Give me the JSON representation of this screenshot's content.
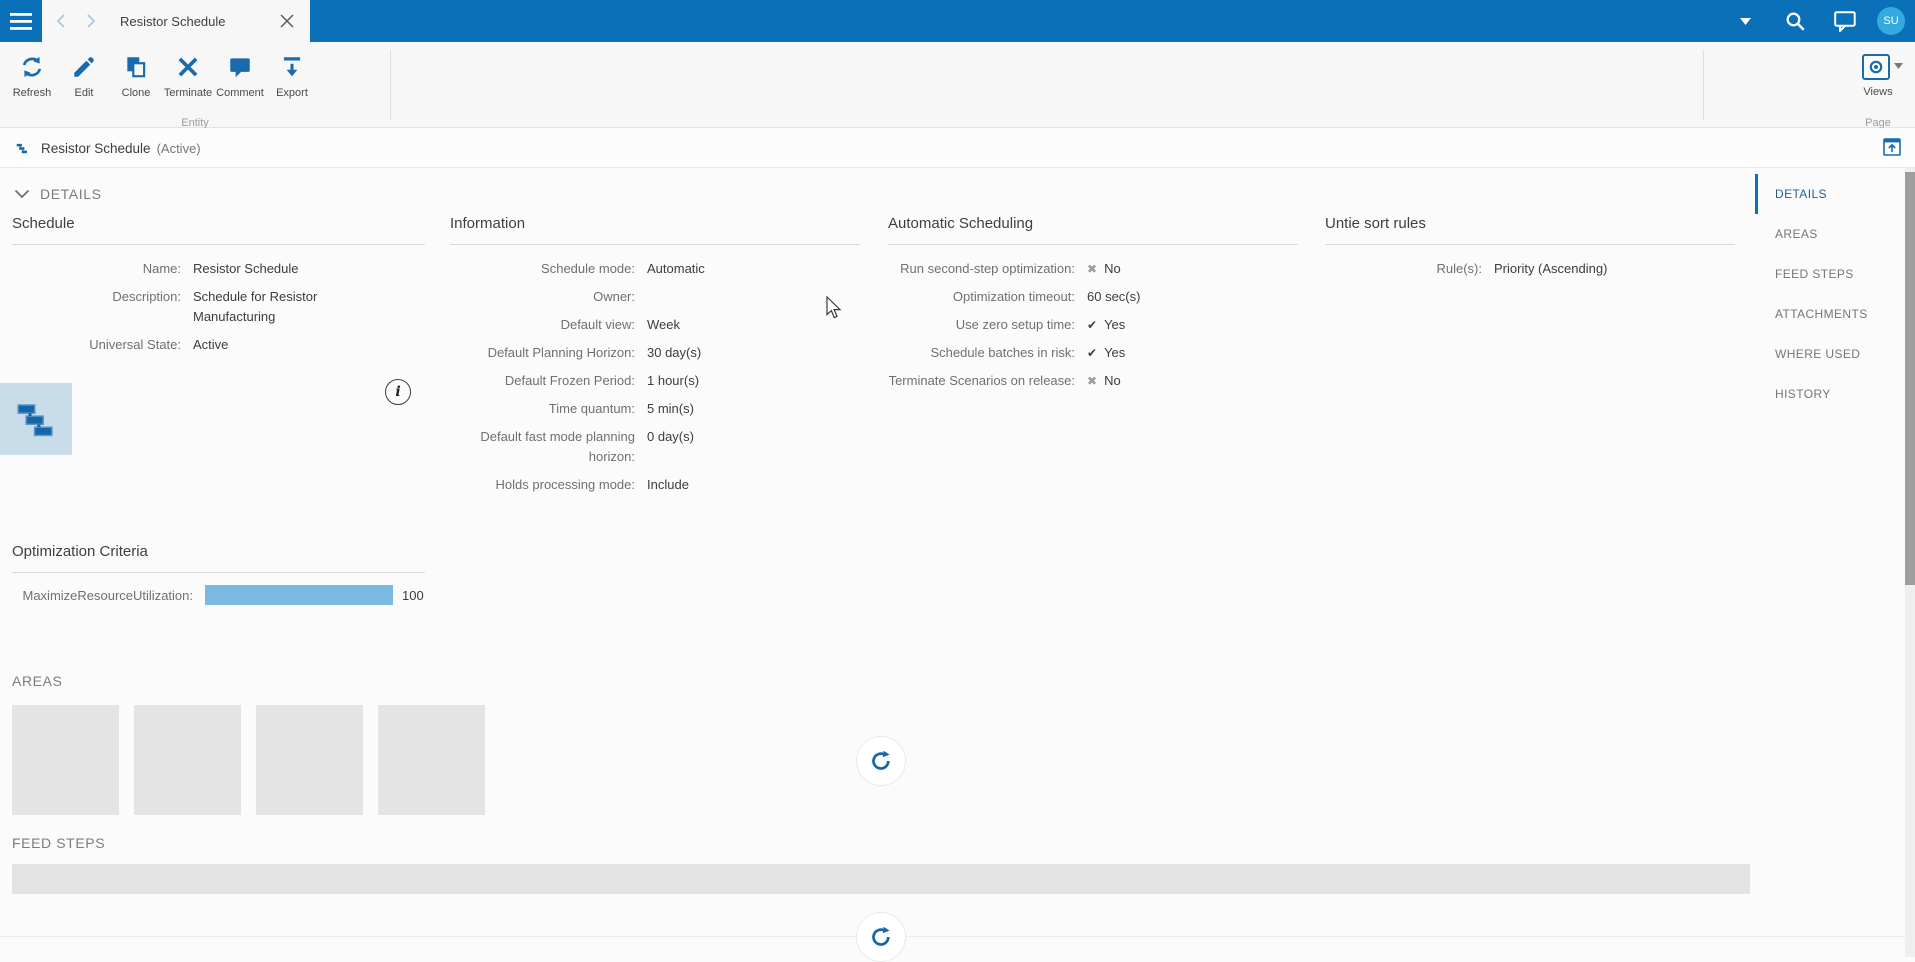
{
  "app": {
    "tab_title": "Resistor Schedule",
    "avatar_initials": "SU"
  },
  "toolbar": {
    "buttons": [
      {
        "label": "Refresh"
      },
      {
        "label": "Edit"
      },
      {
        "label": "Clone"
      },
      {
        "label": "Terminate"
      },
      {
        "label": "Comment"
      },
      {
        "label": "Export"
      }
    ],
    "entity_group_label": "Entity",
    "views_label": "Views",
    "page_group_label": "Page"
  },
  "entity_header": {
    "title": "Resistor Schedule",
    "state": "(Active)"
  },
  "details_section": {
    "title": "DETAILS"
  },
  "sections": {
    "schedule": {
      "title": "Schedule",
      "rows": [
        {
          "label": "Name:",
          "value": "Resistor Schedule"
        },
        {
          "label": "Description:",
          "value": "Schedule for Resistor Manufacturing"
        },
        {
          "label": "Universal State:",
          "value": "Active"
        }
      ]
    },
    "information": {
      "title": "Information",
      "rows": [
        {
          "label": "Schedule mode:",
          "value": "Automatic"
        },
        {
          "label": "Owner:",
          "value": ""
        },
        {
          "label": "Default view:",
          "value": "Week"
        },
        {
          "label": "Default Planning Horizon:",
          "value": "30 day(s)"
        },
        {
          "label": "Default Frozen Period:",
          "value": "1 hour(s)"
        },
        {
          "label": "Time quantum:",
          "value": "5 min(s)"
        },
        {
          "label": "Default fast mode planning horizon:",
          "value": "0 day(s)"
        },
        {
          "label": "Holds processing mode:",
          "value": "Include"
        }
      ]
    },
    "auto_scheduling": {
      "title": "Automatic Scheduling",
      "rows": [
        {
          "label": "Run second-step optimization:",
          "value": "No",
          "mark": "cross"
        },
        {
          "label": "Optimization timeout:",
          "value": "60 sec(s)"
        },
        {
          "label": "Use zero setup time:",
          "value": "Yes",
          "mark": "check"
        },
        {
          "label": "Schedule batches in risk:",
          "value": "Yes",
          "mark": "check"
        },
        {
          "label": "Terminate Scenarios on release:",
          "value": "No",
          "mark": "cross"
        }
      ]
    },
    "untie": {
      "title": "Untie sort rules",
      "rows": [
        {
          "label": "Rule(s):",
          "value": "Priority (Ascending)"
        }
      ]
    },
    "optimization": {
      "title": "Optimization Criteria",
      "criterion_label": "MaximizeResourceUtilization:",
      "criterion_value": "100",
      "bar_percent": 100
    },
    "areas": {
      "title": "AREAS"
    },
    "feed_steps": {
      "title": "FEED STEPS"
    }
  },
  "sidebar": {
    "items": [
      {
        "label": "DETAILS",
        "active": true
      },
      {
        "label": "AREAS",
        "active": false
      },
      {
        "label": "FEED STEPS",
        "active": false
      },
      {
        "label": "ATTACHMENTS",
        "active": false
      },
      {
        "label": "WHERE USED",
        "active": false
      },
      {
        "label": "HISTORY",
        "active": false
      }
    ]
  },
  "colors": {
    "topbar": "#0a70b8",
    "icon": "#1a6aae",
    "bar_fill": "#7cb9e2",
    "avatar": "#35aae1"
  }
}
